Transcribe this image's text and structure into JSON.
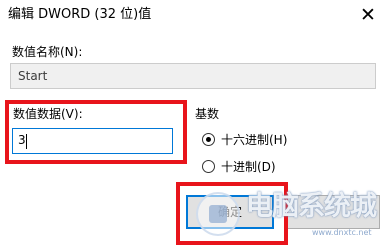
{
  "dialog": {
    "title": "编辑 DWORD (32 位)值",
    "close_glyph": "✕"
  },
  "value_name": {
    "label": "数值名称(N):",
    "value": "Start"
  },
  "value_data": {
    "label": "数值数据(V):",
    "value": "3"
  },
  "base": {
    "label": "基数",
    "options": [
      {
        "label": "十六进制(H)",
        "selected": true
      },
      {
        "label": "十进制(D)",
        "selected": false
      }
    ]
  },
  "buttons": {
    "ok_label": "确定",
    "cancel_label": ""
  },
  "watermark": {
    "text": "电脑系统城",
    "sub": "www.dnxtc.net"
  },
  "colors": {
    "highlight_box": "#e8141b",
    "focus_border": "#0078d7"
  }
}
